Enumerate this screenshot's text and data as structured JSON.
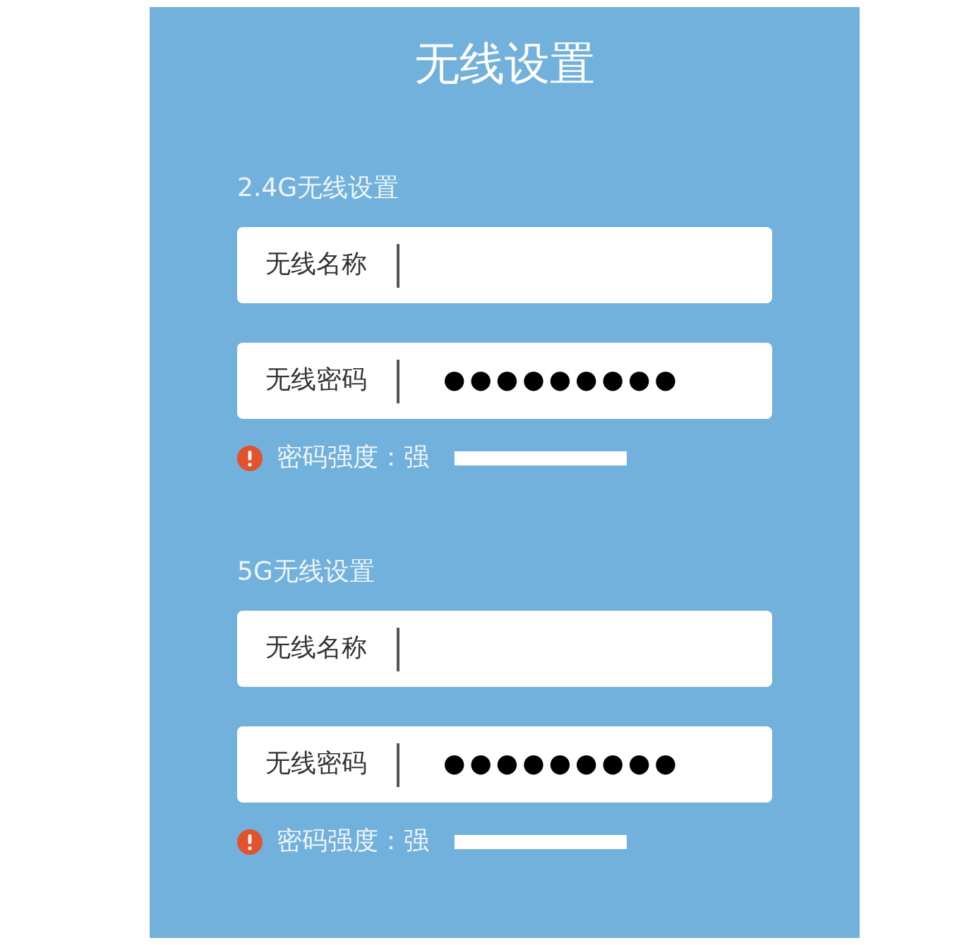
{
  "title": "无线设置",
  "sections": [
    {
      "heading": "2.4G无线设置",
      "fields": [
        {
          "kind": "text",
          "label": "无线名称"
        },
        {
          "kind": "password",
          "label": "无线密码",
          "value": "●●●●●●●●●"
        }
      ],
      "strength": {
        "label": "密码强度：强"
      }
    },
    {
      "heading": "5G无线设置",
      "fields": [
        {
          "kind": "text",
          "label": "无线名称"
        },
        {
          "kind": "password",
          "label": "无线密码",
          "value": "●●●●●●●●●"
        }
      ],
      "strength": {
        "label": "密码强度：强"
      }
    }
  ]
}
